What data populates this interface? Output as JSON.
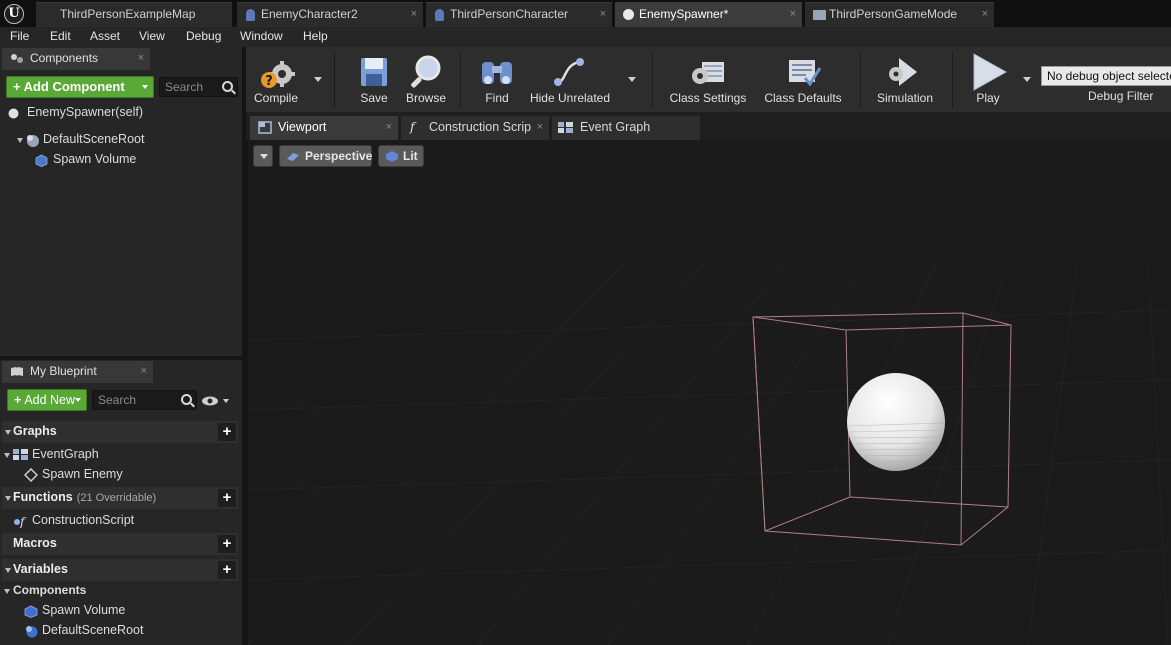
{
  "doc_tabs": [
    {
      "label": "ThirdPersonExampleMap",
      "icon": "map-icon"
    },
    {
      "label": "EnemyCharacter2",
      "icon": "character-blueprint-icon"
    },
    {
      "label": "ThirdPersonCharacter",
      "icon": "character-blueprint-icon"
    },
    {
      "label": "EnemySpawner*",
      "icon": "actor-blueprint-icon",
      "active": true
    },
    {
      "label": "ThirdPersonGameMode",
      "icon": "gamemode-blueprint-icon"
    }
  ],
  "close_glyph": "×",
  "menu": [
    "File",
    "Edit",
    "Asset",
    "View",
    "Debug",
    "Window",
    "Help"
  ],
  "components_panel": {
    "tab_label": "Components",
    "add_button": "Add Component",
    "plus": "+",
    "search_placeholder": "Search",
    "self_label": "EnemySpawner(self)",
    "tree": [
      {
        "label": "DefaultSceneRoot",
        "icon": "scene-root-icon"
      },
      {
        "label": "Spawn Volume",
        "icon": "box-volume-icon"
      }
    ]
  },
  "my_blueprint": {
    "tab_label": "My Blueprint",
    "add_button": "Add New",
    "search_placeholder": "Search",
    "sections": {
      "graphs": {
        "label": "Graphs",
        "items": [
          {
            "label": "EventGraph"
          },
          {
            "label": "Spawn Enemy"
          }
        ]
      },
      "functions": {
        "label": "Functions",
        "sub": "(21 Overridable)",
        "items": [
          {
            "label": "ConstructionScript"
          }
        ]
      },
      "macros": {
        "label": "Macros"
      },
      "variables": {
        "label": "Variables"
      },
      "components": {
        "label": "Components",
        "items": [
          {
            "label": "Spawn Volume"
          },
          {
            "label": "DefaultSceneRoot"
          }
        ]
      }
    }
  },
  "toolbar": {
    "compile": "Compile",
    "save": "Save",
    "browse": "Browse",
    "find": "Find",
    "hide_unrelated": "Hide Unrelated",
    "class_settings": "Class Settings",
    "class_defaults": "Class Defaults",
    "simulation": "Simulation",
    "play": "Play",
    "debug_select": "No debug object selected",
    "debug_filter": "Debug Filter"
  },
  "editor_tabs": [
    {
      "label": "Viewport",
      "active": true
    },
    {
      "label": "Construction Scrip"
    },
    {
      "label": "Event Graph"
    }
  ],
  "viewport": {
    "perspective": "Perspective",
    "lit": "Lit"
  },
  "colors": {
    "green_button": "#5aa836",
    "panel_bg": "#262626",
    "viewport_bg": "#1b1b1b",
    "volume_outline": "#b07d86"
  }
}
